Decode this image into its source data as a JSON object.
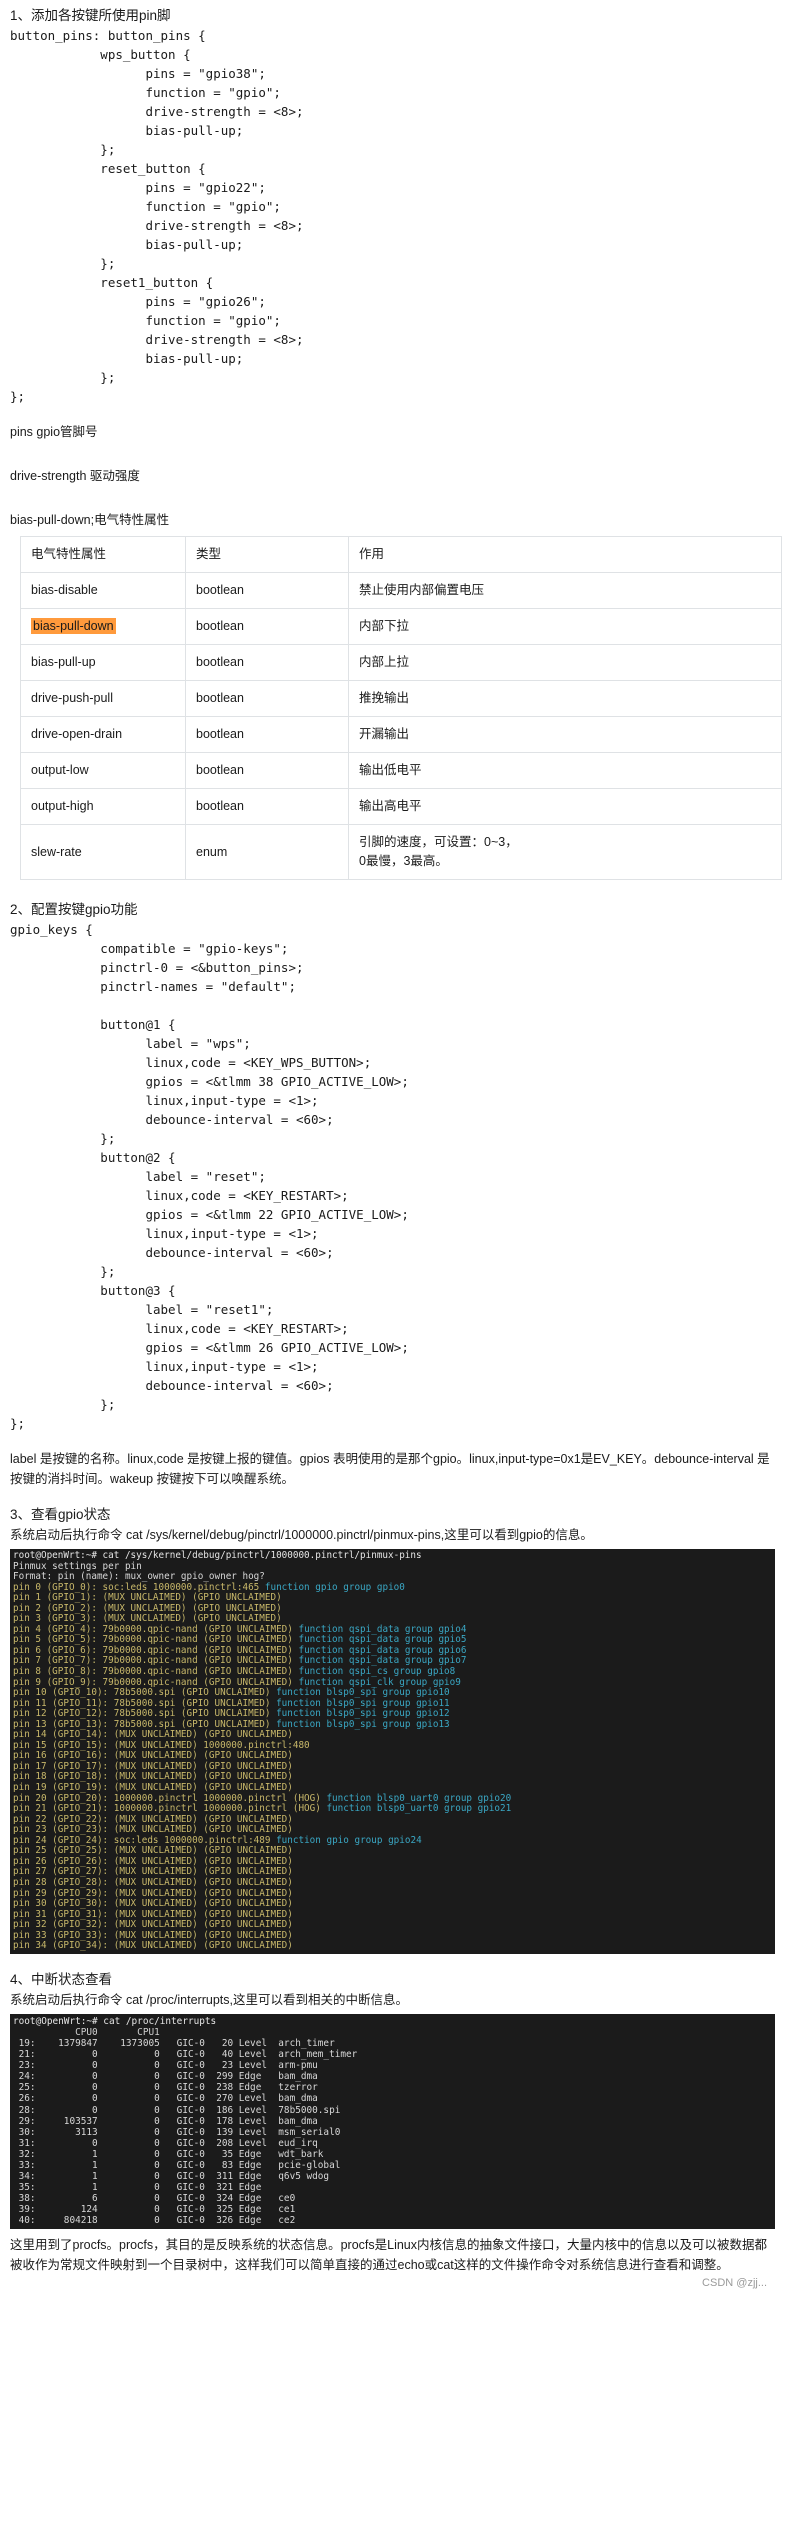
{
  "sections": {
    "s1_heading": "1、添加各按键所使用pin脚",
    "s1_code": "button_pins: button_pins {\n            wps_button {\n                  pins = \"gpio38\";\n                  function = \"gpio\";\n                  drive-strength = <8>;\n                  bias-pull-up;\n            };\n            reset_button {\n                  pins = \"gpio22\";\n                  function = \"gpio\";\n                  drive-strength = <8>;\n                  bias-pull-up;\n            };\n            reset1_button {\n                  pins = \"gpio26\";\n                  function = \"gpio\";\n                  drive-strength = <8>;\n                  bias-pull-up;\n            };\n};",
    "note_pins": "pins gpio管脚号",
    "note_drive": "drive-strength 驱动强度",
    "note_bias": "bias-pull-down;电气特性属性",
    "s2_heading": "2、配置按键gpio功能",
    "s2_code": "gpio_keys {\n            compatible = \"gpio-keys\";\n            pinctrl-0 = <&button_pins>;\n            pinctrl-names = \"default\";\n\n            button@1 {\n                  label = \"wps\";\n                  linux,code = <KEY_WPS_BUTTON>;\n                  gpios = <&tlmm 38 GPIO_ACTIVE_LOW>;\n                  linux,input-type = <1>;\n                  debounce-interval = <60>;\n            };\n            button@2 {\n                  label = \"reset\";\n                  linux,code = <KEY_RESTART>;\n                  gpios = <&tlmm 22 GPIO_ACTIVE_LOW>;\n                  linux,input-type = <1>;\n                  debounce-interval = <60>;\n            };\n            button@3 {\n                  label = \"reset1\";\n                  linux,code = <KEY_RESTART>;\n                  gpios = <&tlmm 26 GPIO_ACTIVE_LOW>;\n                  linux,input-type = <1>;\n                  debounce-interval = <60>;\n            };\n};",
    "s2_note": "label 是按键的名称。linux,code 是按键上报的键值。gpios 表明使用的是那个gpio。linux,input-type=0x1是EV_KEY。debounce-interval 是按键的消抖时间。wakeup 按键按下可以唤醒系统。",
    "s3_heading": "3、查看gpio状态",
    "s3_note": "系统启动后执行命令 cat /sys/kernel/debug/pinctrl/1000000.pinctrl/pinmux-pins,这里可以看到gpio的信息。",
    "s4_heading": "4、中断状态查看",
    "s4_note": "系统启动后执行命令 cat /proc/interrupts,这里可以看到相关的中断信息。",
    "footer_note": "这里用到了procfs。procfs，其目的是反映系统的状态信息。procfs是Linux内核信息的抽象文件接口，大量内核中的信息以及可以被数据都被收作为常规文件映射到一个目录树中，这样我们可以简单直接的通过echo或cat这样的文件操作命令对系统信息进行查看和调整。",
    "watermark": "CSDN @zjj..."
  },
  "table": {
    "headers": [
      "电气特性属性",
      "类型",
      "作用"
    ],
    "rows": [
      {
        "attr": "bias-disable",
        "type": "bootlean",
        "use": "禁止使用内部偏置电压",
        "highlight": false
      },
      {
        "attr": "bias-pull-down",
        "type": "bootlean",
        "use": "内部下拉",
        "highlight": true
      },
      {
        "attr": "bias-pull-up",
        "type": "bootlean",
        "use": "内部上拉",
        "highlight": false
      },
      {
        "attr": "drive-push-pull",
        "type": "bootlean",
        "use": "推挽输出",
        "highlight": false
      },
      {
        "attr": "drive-open-drain",
        "type": "bootlean",
        "use": "开漏输出",
        "highlight": false
      },
      {
        "attr": "output-low",
        "type": "bootlean",
        "use": "输出低电平",
        "highlight": false
      },
      {
        "attr": "output-high",
        "type": "bootlean",
        "use": "输出高电平",
        "highlight": false
      },
      {
        "attr": "slew-rate",
        "type": "enum",
        "use": "引脚的速度，可设置：0~3，\n0最慢，3最高。",
        "highlight": false
      }
    ],
    "highlight_color": "#ff9a3c"
  },
  "terminal1": {
    "prompt": "root@OpenWrt:~# cat /sys/kernel/debug/pinctrl/1000000.pinctrl/pinmux-pins",
    "lines": [
      "Pinmux settings per pin",
      "Format: pin (name): mux_owner gpio_owner hog?",
      "pin 0 (GPIO_0): soc:leds 1000000.pinctrl:465 function gpio group gpio0",
      "pin 1 (GPIO_1): (MUX UNCLAIMED) (GPIO UNCLAIMED)",
      "pin 2 (GPIO_2): (MUX UNCLAIMED) (GPIO UNCLAIMED)",
      "pin 3 (GPIO_3): (MUX UNCLAIMED) (GPIO UNCLAIMED)",
      "pin 4 (GPIO_4): 79b0000.qpic-nand (GPIO UNCLAIMED) function qspi_data group gpio4",
      "pin 5 (GPIO_5): 79b0000.qpic-nand (GPIO UNCLAIMED) function qspi_data group gpio5",
      "pin 6 (GPIO_6): 79b0000.qpic-nand (GPIO UNCLAIMED) function qspi_data group gpio6",
      "pin 7 (GPIO_7): 79b0000.qpic-nand (GPIO UNCLAIMED) function qspi_data group gpio7",
      "pin 8 (GPIO_8): 79b0000.qpic-nand (GPIO UNCLAIMED) function qspi_cs group gpio8",
      "pin 9 (GPIO_9): 79b0000.qpic-nand (GPIO UNCLAIMED) function qspi_clk group gpio9",
      "pin 10 (GPIO_10): 78b5000.spi (GPIO UNCLAIMED) function blsp0_spi group gpio10",
      "pin 11 (GPIO_11): 78b5000.spi (GPIO UNCLAIMED) function blsp0_spi group gpio11",
      "pin 12 (GPIO_12): 78b5000.spi (GPIO UNCLAIMED) function blsp0_spi group gpio12",
      "pin 13 (GPIO_13): 78b5000.spi (GPIO UNCLAIMED) function blsp0_spi group gpio13",
      "pin 14 (GPIO_14): (MUX UNCLAIMED) (GPIO UNCLAIMED)",
      "pin 15 (GPIO_15): (MUX UNCLAIMED) 1000000.pinctrl:480",
      "pin 16 (GPIO_16): (MUX UNCLAIMED) (GPIO UNCLAIMED)",
      "pin 17 (GPIO_17): (MUX UNCLAIMED) (GPIO UNCLAIMED)",
      "pin 18 (GPIO_18): (MUX UNCLAIMED) (GPIO UNCLAIMED)",
      "pin 19 (GPIO_19): (MUX UNCLAIMED) (GPIO UNCLAIMED)",
      "pin 20 (GPIO_20): 1000000.pinctrl 1000000.pinctrl (HOG) function blsp0_uart0 group gpio20",
      "pin 21 (GPIO_21): 1000000.pinctrl 1000000.pinctrl (HOG) function blsp0_uart0 group gpio21",
      "pin 22 (GPIO_22): (MUX UNCLAIMED) (GPIO UNCLAIMED)",
      "pin 23 (GPIO_23): (MUX UNCLAIMED) (GPIO UNCLAIMED)",
      "pin 24 (GPIO_24): soc:leds 1000000.pinctrl:489 function gpio group gpio24",
      "pin 25 (GPIO_25): (MUX UNCLAIMED) (GPIO UNCLAIMED)",
      "pin 26 (GPIO_26): (MUX UNCLAIMED) (GPIO UNCLAIMED)",
      "pin 27 (GPIO_27): (MUX UNCLAIMED) (GPIO UNCLAIMED)",
      "pin 28 (GPIO_28): (MUX UNCLAIMED) (GPIO UNCLAIMED)",
      "pin 29 (GPIO_29): (MUX UNCLAIMED) (GPIO UNCLAIMED)",
      "pin 30 (GPIO_30): (MUX UNCLAIMED) (GPIO UNCLAIMED)",
      "pin 31 (GPIO_31): (MUX UNCLAIMED) (GPIO UNCLAIMED)",
      "pin 32 (GPIO_32): (MUX UNCLAIMED) (GPIO UNCLAIMED)",
      "pin 33 (GPIO_33): (MUX UNCLAIMED) (GPIO UNCLAIMED)",
      "pin 34 (GPIO_34): (MUX UNCLAIMED) (GPIO UNCLAIMED)"
    ]
  },
  "terminal2": {
    "prompt": "root@OpenWrt:~# cat /proc/interrupts",
    "header": "           CPU0       CPU1",
    "rows": [
      {
        "irq": "19:",
        "cpu0": "1379847",
        "cpu1": "1373005",
        "chip": "GIC-0",
        "hw": "20",
        "type": "Level",
        "name": "arch_timer"
      },
      {
        "irq": "21:",
        "cpu0": "0",
        "cpu1": "0",
        "chip": "GIC-0",
        "hw": "40",
        "type": "Level",
        "name": "arch_mem_timer"
      },
      {
        "irq": "23:",
        "cpu0": "0",
        "cpu1": "0",
        "chip": "GIC-0",
        "hw": "23",
        "type": "Level",
        "name": "arm-pmu"
      },
      {
        "irq": "24:",
        "cpu0": "0",
        "cpu1": "0",
        "chip": "GIC-0",
        "hw": "299",
        "type": "Edge",
        "name": "bam_dma"
      },
      {
        "irq": "25:",
        "cpu0": "0",
        "cpu1": "0",
        "chip": "GIC-0",
        "hw": "238",
        "type": "Edge",
        "name": "tzerror"
      },
      {
        "irq": "26:",
        "cpu0": "0",
        "cpu1": "0",
        "chip": "GIC-0",
        "hw": "270",
        "type": "Level",
        "name": "bam_dma"
      },
      {
        "irq": "28:",
        "cpu0": "0",
        "cpu1": "0",
        "chip": "GIC-0",
        "hw": "186",
        "type": "Level",
        "name": "78b5000.spi"
      },
      {
        "irq": "29:",
        "cpu0": "103537",
        "cpu1": "0",
        "chip": "GIC-0",
        "hw": "178",
        "type": "Level",
        "name": "bam_dma"
      },
      {
        "irq": "30:",
        "cpu0": "3113",
        "cpu1": "0",
        "chip": "GIC-0",
        "hw": "139",
        "type": "Level",
        "name": "msm_serial0"
      },
      {
        "irq": "31:",
        "cpu0": "0",
        "cpu1": "0",
        "chip": "GIC-0",
        "hw": "208",
        "type": "Level",
        "name": "eud_irq"
      },
      {
        "irq": "32:",
        "cpu0": "1",
        "cpu1": "0",
        "chip": "GIC-0",
        "hw": "35",
        "type": "Edge",
        "name": "wdt_bark"
      },
      {
        "irq": "33:",
        "cpu0": "1",
        "cpu1": "0",
        "chip": "GIC-0",
        "hw": "83",
        "type": "Edge",
        "name": "pcie-global"
      },
      {
        "irq": "34:",
        "cpu0": "1",
        "cpu1": "0",
        "chip": "GIC-0",
        "hw": "311",
        "type": "Edge",
        "name": "q6v5 wdog"
      },
      {
        "irq": "35:",
        "cpu0": "1",
        "cpu1": "0",
        "chip": "GIC-0",
        "hw": "321",
        "type": "Edge",
        "name": ""
      },
      {
        "irq": "38:",
        "cpu0": "6",
        "cpu1": "0",
        "chip": "GIC-0",
        "hw": "324",
        "type": "Edge",
        "name": "ce0"
      },
      {
        "irq": "39:",
        "cpu0": "124",
        "cpu1": "0",
        "chip": "GIC-0",
        "hw": "325",
        "type": "Edge",
        "name": "ce1"
      },
      {
        "irq": "40:",
        "cpu0": "804218",
        "cpu1": "0",
        "chip": "GIC-0",
        "hw": "326",
        "type": "Edge",
        "name": "ce2"
      }
    ]
  }
}
